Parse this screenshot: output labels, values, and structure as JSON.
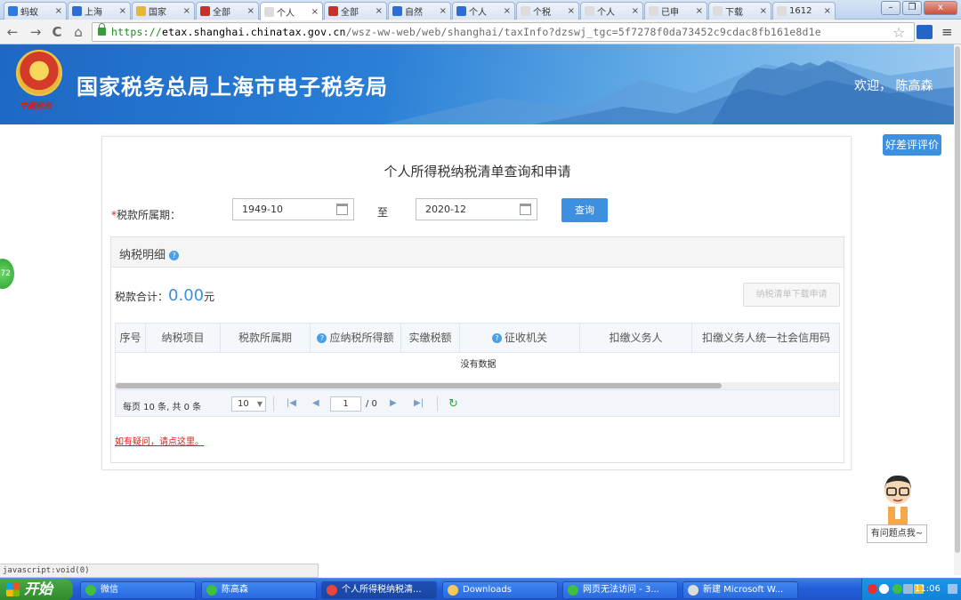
{
  "browser": {
    "tabs": [
      {
        "label": "蚂蚁"
      },
      {
        "label": "上海"
      },
      {
        "label": "国家"
      },
      {
        "label": "全部"
      },
      {
        "label": "个人"
      },
      {
        "label": "全部"
      },
      {
        "label": "自然"
      },
      {
        "label": "个人"
      },
      {
        "label": "个税"
      },
      {
        "label": "个人"
      },
      {
        "label": "已申"
      },
      {
        "label": "下载"
      },
      {
        "label": "1612"
      }
    ],
    "tab_close": "×",
    "url_protocol": "https://",
    "url_host": "etax.shanghai.chinatax.gov.cn",
    "url_path": "/wsz-ww-web/web/shanghai/taxInfo?dzswj_tgc=5f7278f0da73452c9cdac8fb161e8d1e",
    "status_text": "javascript:void(0)",
    "nav_back": "←",
    "nav_forward": "→",
    "nav_reload": "C",
    "nav_home": "⌂",
    "bookmark_star": "☆",
    "menu_glyph": "≡",
    "win_minimize": "–",
    "win_restore": "❐",
    "win_close": "x"
  },
  "banner": {
    "emblem_sub": "中国税务",
    "site_title": "国家税务总局上海市电子税务局",
    "welcome": "欢迎， 陈高森"
  },
  "float": {
    "rate_button": "好差评评价",
    "left_badge": "72",
    "ask_button": "有问题点我~"
  },
  "query": {
    "page_title": "个人所得税纳税清单查询和申请",
    "required_mark": "*",
    "period_label": "税款所属期：",
    "start_date": "1949-10",
    "to_label": "至",
    "end_date": "2020-12",
    "query_button": "查询"
  },
  "detail": {
    "panel_title": "纳税明细",
    "help_glyph": "?",
    "total_label": "税款合计：",
    "total_amount": "0.00",
    "total_unit": "元",
    "download_button": "纳税清单下载申请",
    "columns": [
      {
        "label": "序号"
      },
      {
        "label": "纳税项目"
      },
      {
        "label": "税款所属期"
      },
      {
        "label": "应纳税所得额",
        "help": true
      },
      {
        "label": "实缴税额"
      },
      {
        "label": "征收机关",
        "help": true
      },
      {
        "label": "扣缴义务人"
      },
      {
        "label": "扣缴义务人统一社会信用码"
      }
    ],
    "no_data": "没有数据",
    "help_link": "如有疑问，请点这里。"
  },
  "pager": {
    "summary": "每页 10 条, 共 0 条",
    "page_size": "10",
    "current_page": "1",
    "total_pages": "/ 0",
    "first": "|◀",
    "prev": "◀",
    "next": "▶",
    "last": "▶|",
    "refresh": "↻"
  },
  "taskbar": {
    "start_label": "开始",
    "tasks": [
      {
        "label": "微信",
        "icon_color": "#3fbf3f"
      },
      {
        "label": "陈高森",
        "icon_color": "#3fbf3f"
      },
      {
        "label": "个人所得税纳税清...",
        "icon_color": "#e8453c"
      },
      {
        "label": "Downloads",
        "icon_color": "#f5c85a"
      },
      {
        "label": "网页无法访问 - 3...",
        "icon_color": "#3fbf3f"
      },
      {
        "label": "新建 Microsoft W...",
        "icon_color": "#dcdcdc"
      }
    ],
    "clock": "11:06"
  }
}
